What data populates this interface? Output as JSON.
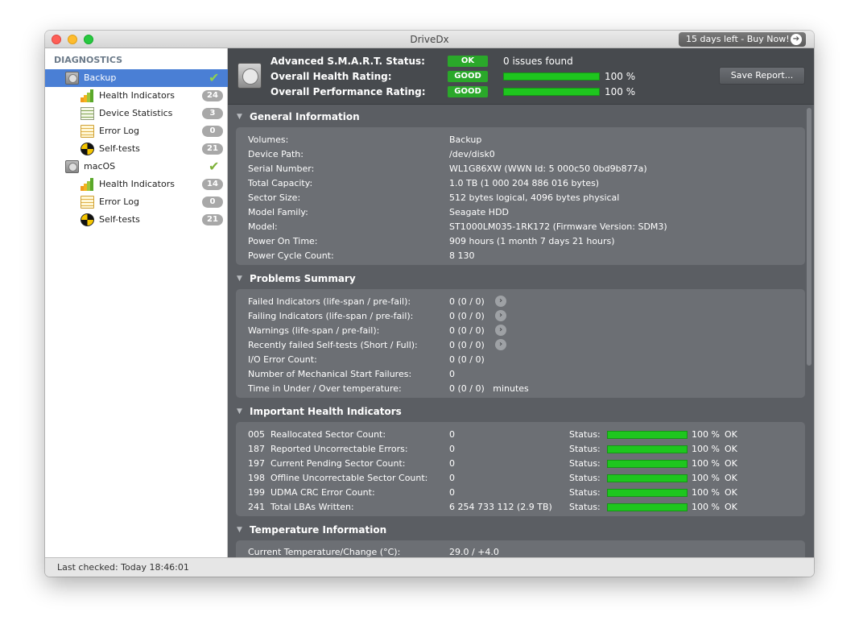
{
  "window": {
    "title": "DriveDx",
    "buy_label": "15 days left - Buy Now!"
  },
  "sidebar": {
    "heading": "DIAGNOSTICS",
    "items": [
      {
        "label": "Backup",
        "type": "disk",
        "checked": true
      },
      {
        "label": "Health Indicators",
        "badge": "24",
        "icon": "health-bars-icon"
      },
      {
        "label": "Device Statistics",
        "badge": "3",
        "icon": "table-icon"
      },
      {
        "label": "Error Log",
        "badge": "0",
        "icon": "log-icon"
      },
      {
        "label": "Self-tests",
        "badge": "21",
        "icon": "self-test-icon"
      },
      {
        "label": "macOS",
        "type": "disk",
        "checked": true
      },
      {
        "label": "Health Indicators",
        "badge": "14",
        "icon": "health-bars-icon"
      },
      {
        "label": "Error Log",
        "badge": "0",
        "icon": "log-icon"
      },
      {
        "label": "Self-tests",
        "badge": "21",
        "icon": "self-test-icon"
      }
    ]
  },
  "header": {
    "smart_label": "Advanced S.M.A.R.T. Status:",
    "smart_status": "OK",
    "smart_note": "0 issues found",
    "health_label": "Overall Health Rating:",
    "health_status": "GOOD",
    "health_pct": "100 %",
    "health_value": 1.0,
    "perf_label": "Overall Performance Rating:",
    "perf_status": "GOOD",
    "perf_pct": "100 %",
    "perf_value": 1.0,
    "save_button": "Save Report..."
  },
  "general": {
    "title": "General Information",
    "rows": [
      {
        "label": "Volumes:",
        "value": "Backup"
      },
      {
        "label": "Device Path:",
        "value": "/dev/disk0"
      },
      {
        "label": "Serial Number:",
        "value": "WL1G86XW (WWN Id: 5 000c50 0bd9b877a)"
      },
      {
        "label": "Total Capacity:",
        "value": "1.0 TB (1 000 204 886 016 bytes)"
      },
      {
        "label": "Sector Size:",
        "value": "512 bytes logical, 4096 bytes physical"
      },
      {
        "label": "Model Family:",
        "value": "Seagate HDD"
      },
      {
        "label": "Model:",
        "value": "ST1000LM035-1RK172  (Firmware Version: SDM3)"
      },
      {
        "label": "Power On Time:",
        "value": "909 hours (1 month 7 days 21 hours)"
      },
      {
        "label": "Power Cycle Count:",
        "value": "8 130"
      }
    ]
  },
  "problems": {
    "title": "Problems Summary",
    "rows": [
      {
        "label": "Failed Indicators (life-span / pre-fail):",
        "value": "0 (0 / 0)",
        "arrow": true
      },
      {
        "label": "Failing Indicators (life-span / pre-fail):",
        "value": "0 (0 / 0)",
        "arrow": true
      },
      {
        "label": "Warnings (life-span / pre-fail):",
        "value": "0 (0 / 0)",
        "arrow": true
      },
      {
        "label": "Recently failed Self-tests (Short / Full):",
        "value": "0 (0 / 0)",
        "arrow": true
      },
      {
        "label": "I/O Error Count:",
        "value": "0 (0 / 0)",
        "arrow": false
      },
      {
        "label": "Number of Mechanical Start Failures:",
        "value": "0",
        "arrow": false
      },
      {
        "label": "Time in Under / Over temperature:",
        "value": "0 (0 / 0)   minutes",
        "arrow": false
      }
    ]
  },
  "health": {
    "title": "Important Health Indicators",
    "status_label": "Status:",
    "rows": [
      {
        "label": "005  Reallocated Sector Count:",
        "value": "0",
        "pct": "100 %",
        "level": 1.0,
        "ok": "OK"
      },
      {
        "label": "187  Reported Uncorrectable Errors:",
        "value": "0",
        "pct": "100 %",
        "level": 1.0,
        "ok": "OK"
      },
      {
        "label": "197  Current Pending Sector Count:",
        "value": "0",
        "pct": "100 %",
        "level": 1.0,
        "ok": "OK"
      },
      {
        "label": "198  Offline Uncorrectable Sector Count:",
        "value": "0",
        "pct": "100 %",
        "level": 1.0,
        "ok": "OK"
      },
      {
        "label": "199  UDMA CRC Error Count:",
        "value": "0",
        "pct": "100 %",
        "level": 1.0,
        "ok": "OK"
      },
      {
        "label": "241  Total LBAs Written:",
        "value": "6 254 733 112 (2.9 TB)",
        "pct": "100 %",
        "level": 1.0,
        "ok": "OK"
      }
    ]
  },
  "temperature": {
    "title": "Temperature Information",
    "rows": [
      {
        "label": "Current Temperature/Change (°C):",
        "value": "29.0 / +4.0"
      }
    ]
  },
  "status": {
    "last_checked": "Last checked: Today 18:46:01"
  }
}
